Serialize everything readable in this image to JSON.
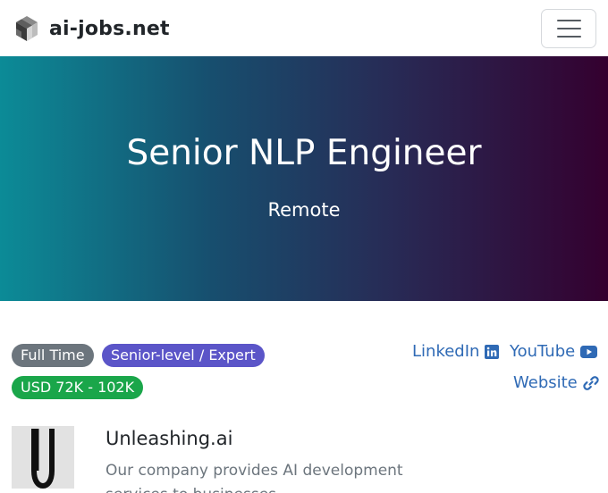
{
  "navbar": {
    "brand": "ai-jobs.net",
    "logo_icon": "cube-logo-icon",
    "menu_icon": "hamburger-menu-icon"
  },
  "hero": {
    "title": "Senior NLP Engineer",
    "location": "Remote",
    "gradient_colors": [
      "#0c8b97",
      "#174e6e",
      "#282a55",
      "#34002f"
    ]
  },
  "badges": {
    "employment_type": "Full Time",
    "level": "Senior-level / Expert",
    "salary": "USD 72K - 102K"
  },
  "links": {
    "linkedin": "LinkedIn",
    "youtube": "YouTube",
    "website": "Website"
  },
  "company": {
    "name": "Unleashing.ai",
    "description": "Our company provides AI development services to businesses"
  },
  "colors": {
    "link": "#2f6ab5",
    "badge_gray": "#6c757d",
    "badge_purple": "#5b55c8",
    "badge_green": "#1aa64a"
  }
}
